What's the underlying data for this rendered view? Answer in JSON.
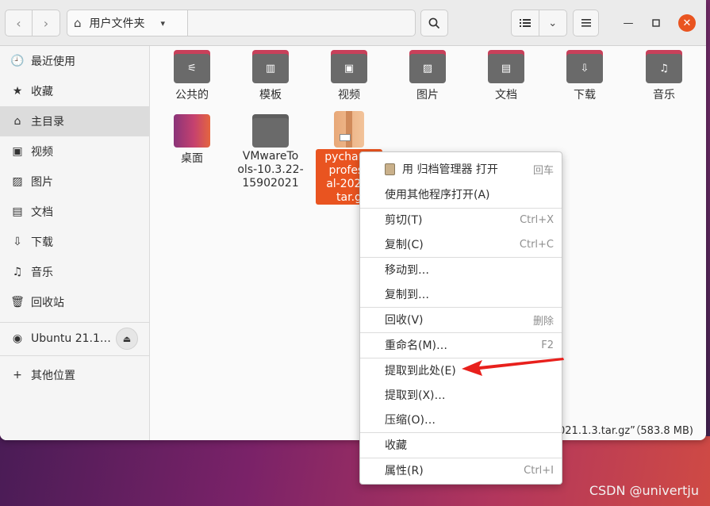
{
  "header": {
    "nav_back": "‹",
    "nav_forward": "›",
    "path_label": "用户文件夹",
    "search_icon": "search-icon",
    "list_view_icon": "list-view-icon",
    "sort_icon": "chevron-down-icon",
    "menu_icon": "hamburger-icon"
  },
  "sidebar": {
    "items": [
      {
        "label": "最近使用",
        "icon": "🕘"
      },
      {
        "label": "收藏",
        "icon": "★"
      },
      {
        "label": "主目录",
        "icon": "⌂"
      },
      {
        "label": "视频",
        "icon": "▣"
      },
      {
        "label": "图片",
        "icon": "▨"
      },
      {
        "label": "文档",
        "icon": "▤"
      },
      {
        "label": "下载",
        "icon": "⇩"
      },
      {
        "label": "音乐",
        "icon": "♫"
      },
      {
        "label": "回收站",
        "icon": "🗑"
      },
      {
        "label": "Ubuntu 21.1…",
        "icon": "◉"
      },
      {
        "label": "其他位置",
        "icon": "+"
      }
    ],
    "eject_icon": "⏏"
  },
  "files": [
    {
      "label": "公共的",
      "glyph": "⚟"
    },
    {
      "label": "模板",
      "glyph": "▥"
    },
    {
      "label": "视频",
      "glyph": "▣"
    },
    {
      "label": "图片",
      "glyph": "▨"
    },
    {
      "label": "文档",
      "glyph": "▤"
    },
    {
      "label": "下载",
      "glyph": "⇩"
    },
    {
      "label": "音乐",
      "glyph": "♫"
    },
    {
      "label": "桌面",
      "glyph": ""
    },
    {
      "label": "VMwareTools-10.3.22-15902021",
      "line1": "VMwareTo",
      "line2": "ols-10.3.22-",
      "line3": "15902021",
      "glyph": ""
    }
  ],
  "archive": {
    "line1": "pycharm",
    "line2": "profess",
    "line3": "al-2021.",
    "line4": "tar.g"
  },
  "status_text": "021.1.3.tar.gz”（583.8 MB)",
  "context_menu": {
    "items": [
      {
        "label": "用 归档管理器 打开",
        "accel": "回车"
      },
      {
        "label": "使用其他程序打开(A)",
        "accel": ""
      },
      {
        "label": "剪切(T)",
        "accel": "Ctrl+X"
      },
      {
        "label": "复制(C)",
        "accel": "Ctrl+C"
      },
      {
        "label": "移动到…",
        "accel": ""
      },
      {
        "label": "复制到…",
        "accel": ""
      },
      {
        "label": "回收(V)",
        "accel": "删除"
      },
      {
        "label": "重命名(M)…",
        "accel": "F2"
      },
      {
        "label": "提取到此处(E)",
        "accel": ""
      },
      {
        "label": "提取到(X)…",
        "accel": ""
      },
      {
        "label": "压缩(O)…",
        "accel": ""
      },
      {
        "label": "收藏",
        "accel": ""
      },
      {
        "label": "属性(R)",
        "accel": "Ctrl+I"
      }
    ]
  },
  "watermark": "CSDN @univertju",
  "colors": {
    "accent": "#e95420",
    "arrow": "#e8201c"
  }
}
